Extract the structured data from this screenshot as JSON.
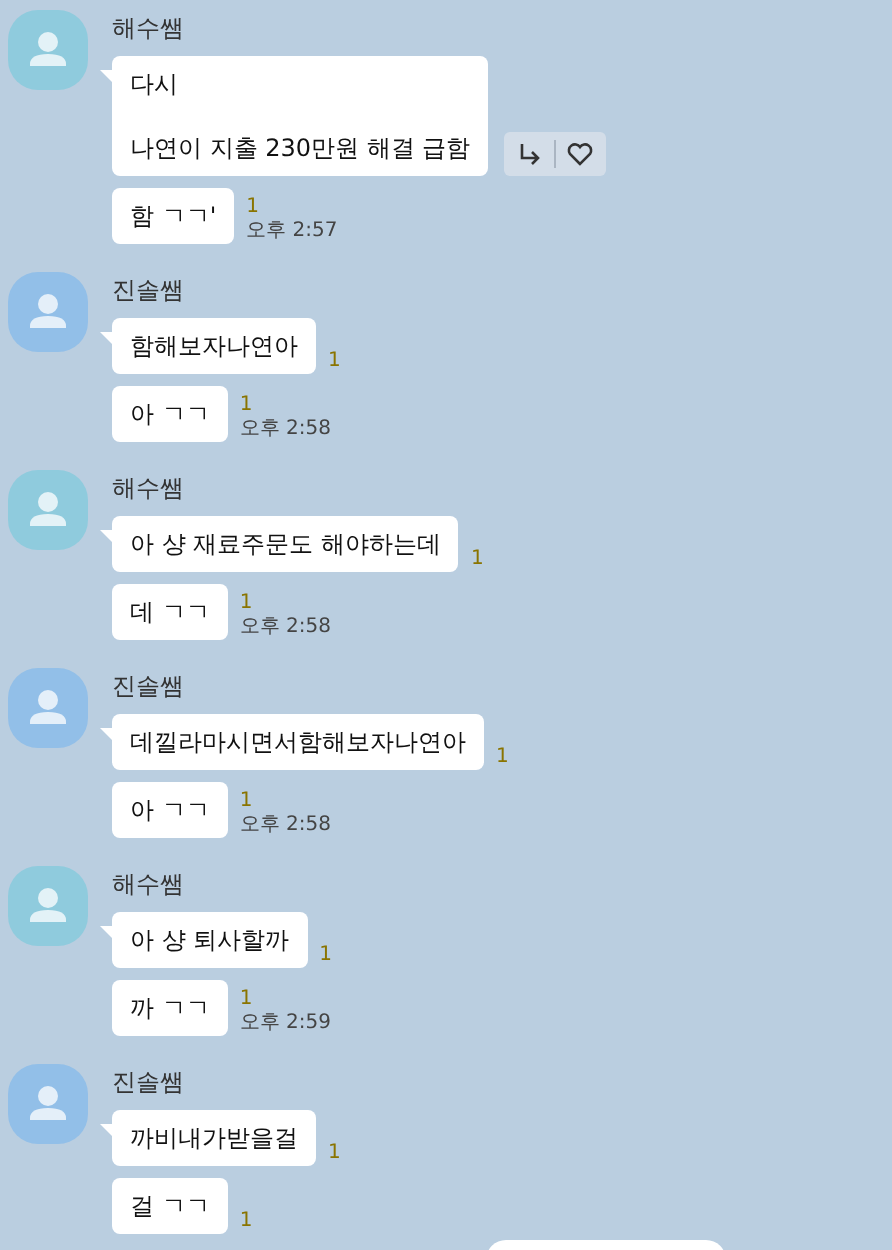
{
  "groups": [
    {
      "sender": "해수쌤",
      "color": "#8fcbdd",
      "messages": [
        {
          "text": "다시\n\n나연이 지출 230만원 해결 급함",
          "actions": true
        },
        {
          "text": "함 ㄱㄱ'",
          "unread": "1",
          "time": "오후 2:57",
          "actions": false
        }
      ]
    },
    {
      "sender": "진솔쌤",
      "color": "#92bfe8",
      "messages": [
        {
          "text": "함해보자나연아",
          "unread": "1",
          "actions": false
        },
        {
          "text": "아 ㄱㄱ",
          "unread": "1",
          "time": "오후 2:58",
          "actions": false
        }
      ]
    },
    {
      "sender": "해수쌤",
      "color": "#8fcbdd",
      "messages": [
        {
          "text": "아 샹 재료주문도 해야하는데",
          "unread": "1",
          "actions": false
        },
        {
          "text": "데 ㄱㄱ",
          "unread": "1",
          "time": "오후 2:58",
          "actions": false
        }
      ]
    },
    {
      "sender": "진솔쌤",
      "color": "#92bfe8",
      "messages": [
        {
          "text": "데낄라마시면서함해보자나연아",
          "unread": "1",
          "actions": false
        },
        {
          "text": "아 ㄱㄱ",
          "unread": "1",
          "time": "오후 2:58",
          "actions": false
        }
      ]
    },
    {
      "sender": "해수쌤",
      "color": "#8fcbdd",
      "messages": [
        {
          "text": "아 샹 퇴사할까",
          "unread": "1",
          "actions": false
        },
        {
          "text": "까 ㄱㄱ",
          "unread": "1",
          "time": "오후 2:59",
          "actions": false
        }
      ]
    },
    {
      "sender": "진솔쌤",
      "color": "#92bfe8",
      "messages": [
        {
          "text": "까비내가받을걸",
          "unread": "1",
          "actions": false
        },
        {
          "text": "걸 ㄱㄱ",
          "unread": "1",
          "actions": false
        }
      ]
    }
  ]
}
